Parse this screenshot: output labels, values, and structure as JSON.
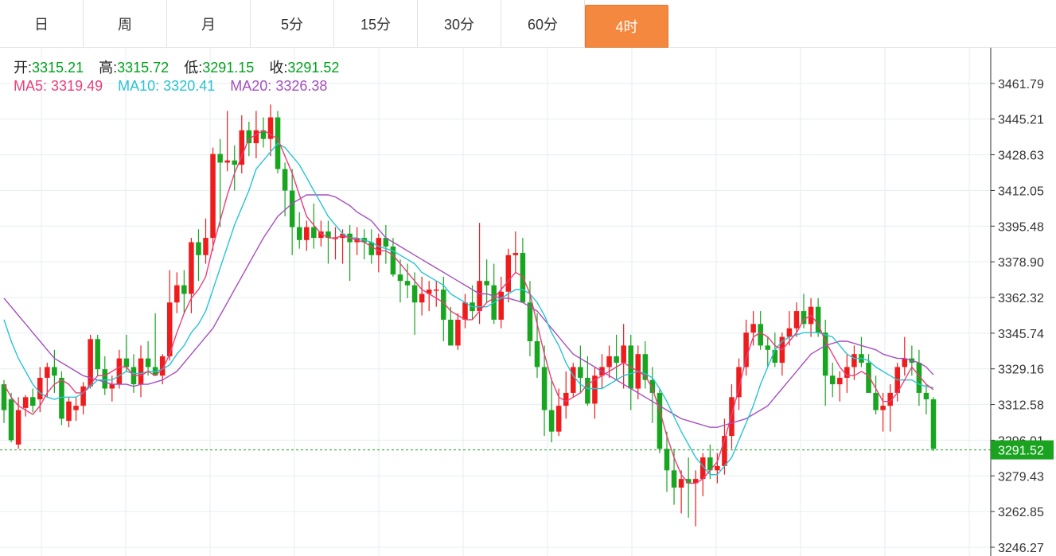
{
  "tabs": [
    {
      "label": "日",
      "active": false
    },
    {
      "label": "周",
      "active": false
    },
    {
      "label": "月",
      "active": false
    },
    {
      "label": "5分",
      "active": false
    },
    {
      "label": "15分",
      "active": false
    },
    {
      "label": "30分",
      "active": false
    },
    {
      "label": "60分",
      "active": false
    },
    {
      "label": "4时",
      "active": true
    }
  ],
  "ohlc_info": {
    "open_label": "开:",
    "open": "3315.21",
    "high_label": "高:",
    "high": "3315.72",
    "low_label": "低:",
    "low": "3291.15",
    "close_label": "收:",
    "close": "3291.52"
  },
  "ma_info": {
    "ma5_label": "MA5:",
    "ma5": "3319.49",
    "ma10_label": "MA10:",
    "ma10": "3320.41",
    "ma20_label": "MA20:",
    "ma20": "3326.38"
  },
  "colors": {
    "up": "#ee1c1c",
    "down": "#18a51f",
    "ma5": "#e8407a",
    "ma10": "#29c3d4",
    "ma20": "#a64fc0",
    "last_price": "#1aa31f",
    "active_tab": "#f4883f"
  },
  "chart_data": {
    "type": "candlestick",
    "ylim": [
      3246.27,
      3478.37
    ],
    "y_ticks": [
      "3461.79",
      "3445.21",
      "3428.63",
      "3412.05",
      "3395.48",
      "3378.90",
      "3362.32",
      "3345.74",
      "3329.16",
      "3312.58",
      "3296.01",
      "3279.43",
      "3262.85",
      "3246.27"
    ],
    "last_price": "3291.52",
    "candles": [
      [
        3322,
        3324,
        3304,
        3310
      ],
      [
        3315,
        3318,
        3295,
        3296
      ],
      [
        3294,
        3316,
        3292,
        3310
      ],
      [
        3311,
        3317,
        3307,
        3316
      ],
      [
        3316,
        3320,
        3309,
        3312
      ],
      [
        3315,
        3330,
        3309,
        3325
      ],
      [
        3325,
        3332,
        3316,
        3330
      ],
      [
        3330,
        3338,
        3318,
        3326
      ],
      [
        3325,
        3328,
        3303,
        3306
      ],
      [
        3305,
        3316,
        3302,
        3314
      ],
      [
        3310,
        3316,
        3305,
        3312
      ],
      [
        3312,
        3323,
        3308,
        3321
      ],
      [
        3321,
        3345,
        3320,
        3343
      ],
      [
        3343,
        3345,
        3326,
        3329
      ],
      [
        3329,
        3335,
        3317,
        3320
      ],
      [
        3320,
        3326,
        3314,
        3322
      ],
      [
        3322,
        3338,
        3320,
        3334
      ],
      [
        3334,
        3345,
        3328,
        3330
      ],
      [
        3330,
        3336,
        3318,
        3322
      ],
      [
        3322,
        3340,
        3316,
        3334
      ],
      [
        3334,
        3342,
        3326,
        3330
      ],
      [
        3330,
        3355,
        3328,
        3326
      ],
      [
        3326,
        3336,
        3322,
        3335
      ],
      [
        3335,
        3375,
        3333,
        3360
      ],
      [
        3360,
        3374,
        3355,
        3368
      ],
      [
        3368,
        3375,
        3355,
        3364
      ],
      [
        3364,
        3390,
        3355,
        3388
      ],
      [
        3388,
        3394,
        3370,
        3382
      ],
      [
        3382,
        3399,
        3378,
        3390
      ],
      [
        3390,
        3432,
        3384,
        3429
      ],
      [
        3429,
        3436,
        3395,
        3425
      ],
      [
        3425,
        3449,
        3421,
        3426
      ],
      [
        3426,
        3433,
        3412,
        3424
      ],
      [
        3424,
        3447,
        3420,
        3440
      ],
      [
        3440,
        3444,
        3428,
        3434
      ],
      [
        3434,
        3449,
        3427,
        3440
      ],
      [
        3440,
        3446,
        3432,
        3436
      ],
      [
        3436,
        3452,
        3428,
        3446
      ],
      [
        3446,
        3449,
        3420,
        3422
      ],
      [
        3422,
        3425,
        3400,
        3412
      ],
      [
        3412,
        3422,
        3382,
        3395
      ],
      [
        3395,
        3402,
        3385,
        3389
      ],
      [
        3389,
        3398,
        3384,
        3395
      ],
      [
        3395,
        3406,
        3385,
        3390
      ],
      [
        3390,
        3398,
        3386,
        3393
      ],
      [
        3393,
        3398,
        3378,
        3390
      ],
      [
        3390,
        3395,
        3380,
        3390
      ],
      [
        3390,
        3394,
        3378,
        3392
      ],
      [
        3392,
        3396,
        3370,
        3388
      ],
      [
        3388,
        3395,
        3382,
        3390
      ],
      [
        3390,
        3394,
        3380,
        3388
      ],
      [
        3388,
        3394,
        3378,
        3382
      ],
      [
        3382,
        3392,
        3374,
        3390
      ],
      [
        3390,
        3396,
        3378,
        3386
      ],
      [
        3386,
        3390,
        3372,
        3373
      ],
      [
        3373,
        3380,
        3360,
        3370
      ],
      [
        3370,
        3378,
        3362,
        3368
      ],
      [
        3368,
        3374,
        3345,
        3360
      ],
      [
        3360,
        3372,
        3354,
        3364
      ],
      [
        3364,
        3370,
        3356,
        3366
      ],
      [
        3366,
        3370,
        3358,
        3366
      ],
      [
        3366,
        3372,
        3342,
        3352
      ],
      [
        3352,
        3358,
        3340,
        3340
      ],
      [
        3340,
        3355,
        3338,
        3352
      ],
      [
        3352,
        3364,
        3348,
        3360
      ],
      [
        3360,
        3368,
        3352,
        3356
      ],
      [
        3356,
        3397,
        3350,
        3370
      ],
      [
        3370,
        3380,
        3360,
        3368
      ],
      [
        3368,
        3378,
        3350,
        3352
      ],
      [
        3352,
        3372,
        3348,
        3365
      ],
      [
        3365,
        3385,
        3360,
        3382
      ],
      [
        3382,
        3393,
        3374,
        3383
      ],
      [
        3383,
        3390,
        3370,
        3360
      ],
      [
        3360,
        3370,
        3335,
        3342
      ],
      [
        3342,
        3355,
        3325,
        3330
      ],
      [
        3330,
        3340,
        3298,
        3310
      ],
      [
        3310,
        3325,
        3295,
        3300
      ],
      [
        3300,
        3320,
        3298,
        3312
      ],
      [
        3312,
        3328,
        3306,
        3318
      ],
      [
        3318,
        3332,
        3316,
        3330
      ],
      [
        3330,
        3340,
        3318,
        3325
      ],
      [
        3325,
        3335,
        3312,
        3313
      ],
      [
        3313,
        3330,
        3306,
        3326
      ],
      [
        3326,
        3336,
        3320,
        3330
      ],
      [
        3330,
        3340,
        3325,
        3335
      ],
      [
        3335,
        3345,
        3324,
        3332
      ],
      [
        3332,
        3350,
        3320,
        3340
      ],
      [
        3340,
        3345,
        3310,
        3320
      ],
      [
        3320,
        3340,
        3315,
        3336
      ],
      [
        3336,
        3342,
        3320,
        3324
      ],
      [
        3324,
        3330,
        3304,
        3318
      ],
      [
        3318,
        3320,
        3290,
        3292
      ],
      [
        3292,
        3300,
        3272,
        3282
      ],
      [
        3282,
        3292,
        3266,
        3274
      ],
      [
        3274,
        3282,
        3262,
        3278
      ],
      [
        3278,
        3288,
        3260,
        3276
      ],
      [
        3276,
        3282,
        3256,
        3278
      ],
      [
        3278,
        3290,
        3270,
        3288
      ],
      [
        3288,
        3294,
        3278,
        3282
      ],
      [
        3282,
        3290,
        3276,
        3284
      ],
      [
        3284,
        3306,
        3280,
        3298
      ],
      [
        3298,
        3322,
        3292,
        3316
      ],
      [
        3316,
        3334,
        3310,
        3330
      ],
      [
        3330,
        3352,
        3326,
        3346
      ],
      [
        3346,
        3356,
        3340,
        3350
      ],
      [
        3350,
        3356,
        3338,
        3340
      ],
      [
        3340,
        3344,
        3330,
        3338
      ],
      [
        3338,
        3346,
        3330,
        3332
      ],
      [
        3332,
        3346,
        3326,
        3344
      ],
      [
        3344,
        3356,
        3340,
        3348
      ],
      [
        3348,
        3360,
        3344,
        3356
      ],
      [
        3356,
        3364,
        3348,
        3350
      ],
      [
        3350,
        3362,
        3344,
        3358
      ],
      [
        3358,
        3362,
        3344,
        3346
      ],
      [
        3346,
        3352,
        3312,
        3326
      ],
      [
        3326,
        3332,
        3316,
        3322
      ],
      [
        3322,
        3328,
        3314,
        3325
      ],
      [
        3325,
        3336,
        3318,
        3330
      ],
      [
        3330,
        3340,
        3324,
        3336
      ],
      [
        3336,
        3344,
        3330,
        3332
      ],
      [
        3332,
        3336,
        3318,
        3318
      ],
      [
        3318,
        3326,
        3308,
        3310
      ],
      [
        3310,
        3318,
        3300,
        3312
      ],
      [
        3312,
        3322,
        3300,
        3318
      ],
      [
        3318,
        3332,
        3314,
        3330
      ],
      [
        3330,
        3344,
        3326,
        3334
      ],
      [
        3334,
        3340,
        3326,
        3332
      ],
      [
        3332,
        3338,
        3312,
        3318
      ],
      [
        3318,
        3322,
        3308,
        3315
      ],
      [
        3315,
        3316,
        3291,
        3292
      ]
    ],
    "ma5": [
      3322,
      3316,
      3312,
      3310,
      3308,
      3312,
      3318,
      3322,
      3324,
      3322,
      3318,
      3318,
      3322,
      3326,
      3326,
      3328,
      3330,
      3330,
      3326,
      3326,
      3328,
      3326,
      3329,
      3336,
      3346,
      3355,
      3362,
      3366,
      3372,
      3386,
      3398,
      3410,
      3420,
      3428,
      3436,
      3438,
      3440,
      3438,
      3436,
      3428,
      3420,
      3410,
      3400,
      3396,
      3392,
      3390,
      3390,
      3391,
      3390,
      3389,
      3388,
      3386,
      3384,
      3384,
      3382,
      3378,
      3374,
      3370,
      3366,
      3364,
      3362,
      3360,
      3356,
      3354,
      3352,
      3352,
      3356,
      3360,
      3362,
      3366,
      3370,
      3374,
      3372,
      3364,
      3350,
      3336,
      3324,
      3316,
      3314,
      3316,
      3318,
      3322,
      3324,
      3326,
      3328,
      3330,
      3332,
      3330,
      3328,
      3326,
      3320,
      3310,
      3298,
      3288,
      3280,
      3276,
      3276,
      3278,
      3282,
      3286,
      3296,
      3308,
      3320,
      3334,
      3344,
      3346,
      3344,
      3340,
      3338,
      3342,
      3346,
      3352,
      3354,
      3350,
      3342,
      3336,
      3330,
      3326,
      3326,
      3328,
      3326,
      3320,
      3314,
      3314,
      3318,
      3324,
      3330,
      3326,
      3322,
      3319.49
    ],
    "ma10": [
      3352,
      3342,
      3334,
      3328,
      3322,
      3318,
      3316,
      3315,
      3316,
      3316,
      3316,
      3318,
      3321,
      3324,
      3324,
      3324,
      3326,
      3328,
      3327,
      3327,
      3328,
      3328,
      3329,
      3331,
      3336,
      3340,
      3346,
      3350,
      3356,
      3366,
      3376,
      3386,
      3396,
      3404,
      3412,
      3422,
      3426,
      3430,
      3434,
      3432,
      3428,
      3424,
      3418,
      3412,
      3406,
      3400,
      3396,
      3392,
      3390,
      3390,
      3389,
      3388,
      3386,
      3385,
      3384,
      3382,
      3380,
      3378,
      3374,
      3372,
      3370,
      3368,
      3364,
      3362,
      3360,
      3358,
      3358,
      3358,
      3360,
      3362,
      3364,
      3366,
      3366,
      3364,
      3360,
      3354,
      3346,
      3340,
      3332,
      3326,
      3322,
      3320,
      3320,
      3320,
      3322,
      3324,
      3326,
      3327,
      3328,
      3327,
      3325,
      3320,
      3314,
      3307,
      3300,
      3294,
      3288,
      3284,
      3280,
      3280,
      3284,
      3288,
      3296,
      3304,
      3312,
      3322,
      3330,
      3338,
      3342,
      3344,
      3345,
      3346,
      3346,
      3346,
      3345,
      3344,
      3340,
      3336,
      3334,
      3334,
      3333,
      3330,
      3328,
      3326,
      3324,
      3324,
      3324,
      3322,
      3321,
      3320.41
    ],
    "ma20": [
      3362,
      3358,
      3354,
      3350,
      3346,
      3342,
      3338,
      3334,
      3332,
      3330,
      3328,
      3326,
      3325,
      3324,
      3323,
      3322,
      3322,
      3322,
      3321,
      3322,
      3322,
      3323,
      3324,
      3326,
      3328,
      3332,
      3336,
      3340,
      3344,
      3348,
      3354,
      3360,
      3366,
      3372,
      3378,
      3384,
      3390,
      3395,
      3400,
      3403,
      3406,
      3408,
      3410,
      3410,
      3410,
      3410,
      3409,
      3407,
      3405,
      3402,
      3400,
      3398,
      3394,
      3390,
      3388,
      3386,
      3384,
      3382,
      3380,
      3378,
      3376,
      3374,
      3372,
      3370,
      3368,
      3366,
      3364,
      3364,
      3363,
      3362,
      3362,
      3361,
      3360,
      3358,
      3356,
      3352,
      3348,
      3344,
      3340,
      3336,
      3334,
      3332,
      3330,
      3328,
      3326,
      3324,
      3322,
      3320,
      3318,
      3316,
      3314,
      3312,
      3310,
      3308,
      3306,
      3305,
      3304,
      3303,
      3302,
      3302,
      3303,
      3304,
      3305,
      3306,
      3308,
      3310,
      3312,
      3316,
      3320,
      3324,
      3328,
      3332,
      3336,
      3338,
      3340,
      3341,
      3342,
      3342,
      3341,
      3340,
      3339,
      3338,
      3336,
      3335,
      3334,
      3334,
      3333,
      3332,
      3330,
      3326.38
    ]
  }
}
